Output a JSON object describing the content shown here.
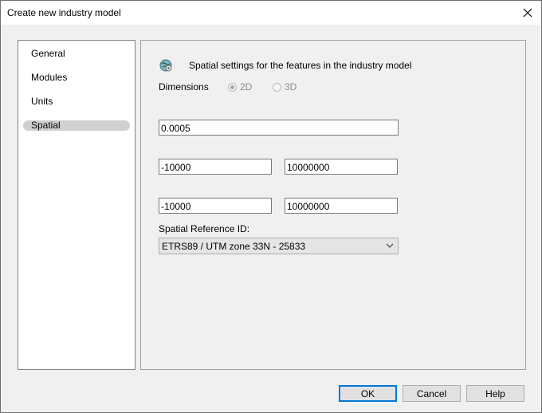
{
  "window": {
    "title": "Create new industry model"
  },
  "nav": {
    "items": [
      {
        "label": "General"
      },
      {
        "label": "Modules"
      },
      {
        "label": "Units"
      },
      {
        "label": "Spatial",
        "selected": true
      }
    ]
  },
  "spatial": {
    "header": "Spatial settings for the features in the industry model",
    "dimensions_label": "Dimensions",
    "option_2d": "2D",
    "option_3d": "3D",
    "selected_dimension": "2D",
    "tolerance_value": "0.0005",
    "x_min_value": "-10000",
    "x_max_value": "10000000",
    "y_min_value": "-10000",
    "y_max_value": "10000000",
    "srid_label": "Spatial Reference ID:",
    "srid_value": "ETRS89 / UTM zone 33N - 25833"
  },
  "buttons": {
    "ok": "OK",
    "cancel": "Cancel",
    "help": "Help"
  },
  "icons": {
    "close": "close-icon",
    "globe": "globe-settings-icon",
    "dropdown": "chevron-down-icon"
  },
  "colors": {
    "accent": "#0078d7",
    "selected_nav": "#d0d0d0",
    "disabled_text": "#8d8d8d"
  }
}
